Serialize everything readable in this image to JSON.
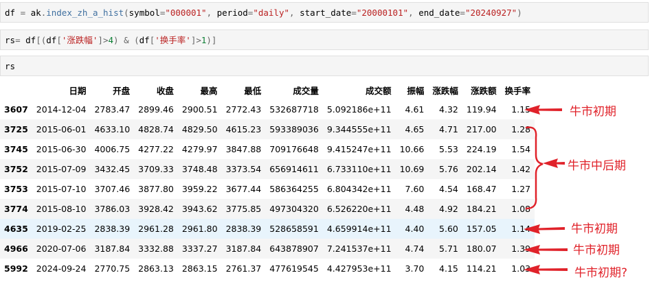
{
  "cells": {
    "c1": [
      {
        "t": "df",
        "k": "var"
      },
      {
        "t": " = ",
        "k": "op"
      },
      {
        "t": "ak",
        "k": "var"
      },
      {
        "t": ".",
        "k": "op"
      },
      {
        "t": "index_zh_a_hist",
        "k": "fn"
      },
      {
        "t": "(",
        "k": "op"
      },
      {
        "t": "symbol",
        "k": "var"
      },
      {
        "t": "=",
        "k": "op"
      },
      {
        "t": "\"000001\"",
        "k": "str"
      },
      {
        "t": ", ",
        "k": "op"
      },
      {
        "t": "period",
        "k": "var"
      },
      {
        "t": "=",
        "k": "op"
      },
      {
        "t": "\"daily\"",
        "k": "str"
      },
      {
        "t": ", ",
        "k": "op"
      },
      {
        "t": "start_date",
        "k": "var"
      },
      {
        "t": "=",
        "k": "op"
      },
      {
        "t": "\"20000101\"",
        "k": "str"
      },
      {
        "t": ", ",
        "k": "op"
      },
      {
        "t": "end_date",
        "k": "var"
      },
      {
        "t": "=",
        "k": "op"
      },
      {
        "t": "\"20240927\"",
        "k": "str"
      },
      {
        "t": ")",
        "k": "op"
      }
    ],
    "c2": [
      {
        "t": "rs",
        "k": "var"
      },
      {
        "t": "= ",
        "k": "op"
      },
      {
        "t": "df",
        "k": "var"
      },
      {
        "t": "[(",
        "k": "op"
      },
      {
        "t": "df",
        "k": "var"
      },
      {
        "t": "[",
        "k": "op"
      },
      {
        "t": "'涨跌幅'",
        "k": "str"
      },
      {
        "t": "]",
        "k": "op"
      },
      {
        "t": ">",
        "k": "op"
      },
      {
        "t": "4",
        "k": "num"
      },
      {
        "t": ") ",
        "k": "op"
      },
      {
        "t": "&",
        "k": "op"
      },
      {
        "t": " (",
        "k": "op"
      },
      {
        "t": "df",
        "k": "var"
      },
      {
        "t": "[",
        "k": "op"
      },
      {
        "t": "'换手率'",
        "k": "str"
      },
      {
        "t": "]",
        "k": "op"
      },
      {
        "t": ">",
        "k": "op"
      },
      {
        "t": "1",
        "k": "num"
      },
      {
        "t": ")]",
        "k": "op"
      }
    ],
    "c3": [
      {
        "t": "rs",
        "k": "var"
      }
    ]
  },
  "table": {
    "columns": [
      "",
      "日期",
      "开盘",
      "收盘",
      "最高",
      "最低",
      "成交量",
      "成交额",
      "振幅",
      "涨跌幅",
      "涨跌额",
      "换手率"
    ],
    "rows": [
      {
        "idx": "3607",
        "vals": [
          "2014-12-04",
          "2783.47",
          "2899.46",
          "2900.51",
          "2772.43",
          "532687718",
          "5.092186e+11",
          "4.61",
          "4.32",
          "119.94",
          "1.15"
        ]
      },
      {
        "idx": "3725",
        "vals": [
          "2015-06-01",
          "4633.10",
          "4828.74",
          "4829.50",
          "4615.23",
          "593389036",
          "9.344555e+11",
          "4.65",
          "4.71",
          "217.00",
          "1.28"
        ]
      },
      {
        "idx": "3745",
        "vals": [
          "2015-06-30",
          "4006.75",
          "4277.22",
          "4279.97",
          "3847.88",
          "709176648",
          "9.415247e+11",
          "10.66",
          "5.53",
          "224.19",
          "1.54"
        ]
      },
      {
        "idx": "3752",
        "vals": [
          "2015-07-09",
          "3432.45",
          "3709.33",
          "3748.48",
          "3373.54",
          "656914611",
          "6.733110e+11",
          "10.69",
          "5.76",
          "202.14",
          "1.42"
        ]
      },
      {
        "idx": "3753",
        "vals": [
          "2015-07-10",
          "3707.46",
          "3877.80",
          "3959.22",
          "3677.44",
          "586364255",
          "6.804342e+11",
          "7.60",
          "4.54",
          "168.47",
          "1.27"
        ]
      },
      {
        "idx": "3774",
        "vals": [
          "2015-08-10",
          "3786.03",
          "3928.42",
          "3943.62",
          "3775.85",
          "497304320",
          "6.526220e+11",
          "4.48",
          "4.92",
          "184.21",
          "1.08"
        ]
      },
      {
        "idx": "4635",
        "vals": [
          "2019-02-25",
          "2838.39",
          "2961.28",
          "2961.80",
          "2838.39",
          "528658591",
          "4.659914e+11",
          "4.40",
          "5.60",
          "157.05",
          "1.14"
        ],
        "highlight": true
      },
      {
        "idx": "4966",
        "vals": [
          "2020-07-06",
          "3187.84",
          "3332.88",
          "3337.27",
          "3187.84",
          "643878907",
          "7.241537e+11",
          "4.74",
          "5.71",
          "180.07",
          "1.39"
        ]
      },
      {
        "idx": "5992",
        "vals": [
          "2024-09-24",
          "2770.75",
          "2863.13",
          "2863.15",
          "2761.37",
          "477619545",
          "4.427953e+11",
          "3.70",
          "4.15",
          "114.21",
          "1.03"
        ]
      }
    ]
  },
  "annotations": {
    "a1": "牛市初期",
    "a2": "牛市中后期",
    "a3": "牛市初期",
    "a4": "牛市初期",
    "a5": "牛市初期?"
  },
  "colors": {
    "annotation": "#e0222a",
    "cell_bg": "#f5f5f5",
    "row_alt": "#f5f5f5",
    "row_hover": "#e8f4fc"
  }
}
